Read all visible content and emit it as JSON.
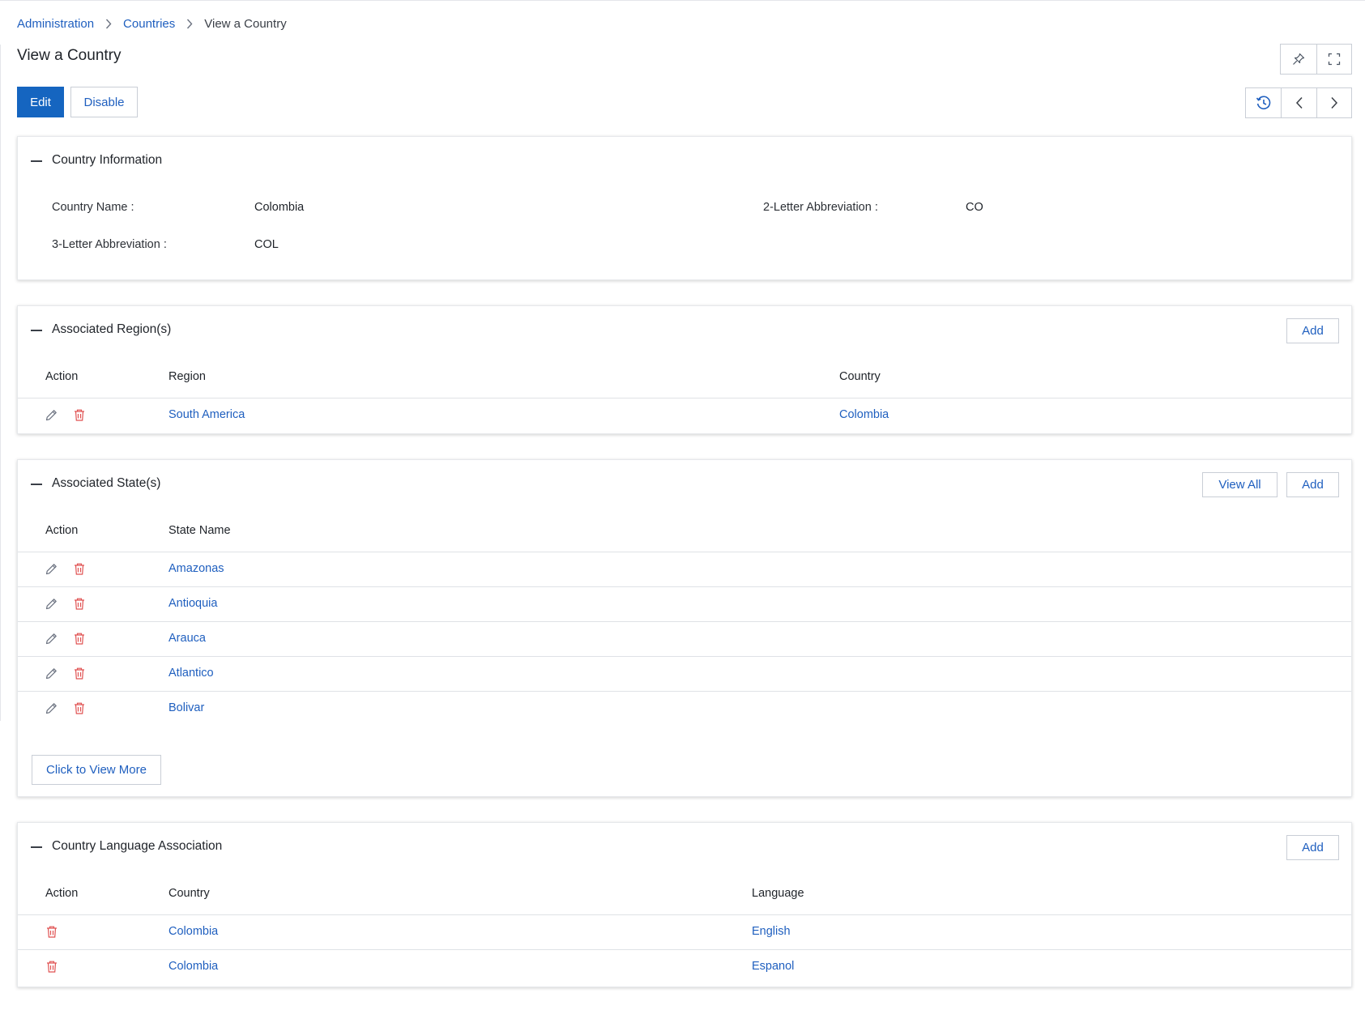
{
  "breadcrumb": {
    "items": [
      "Administration",
      "Countries"
    ],
    "current": "View a Country"
  },
  "page": {
    "title": "View a Country",
    "edit_label": "Edit",
    "disable_label": "Disable"
  },
  "country_info": {
    "title": "Country Information",
    "fields": {
      "country_name_label": "Country Name :",
      "country_name_value": "Colombia",
      "abbr2_label": "2-Letter Abbreviation :",
      "abbr2_value": "CO",
      "abbr3_label": "3-Letter Abbreviation :",
      "abbr3_value": "COL"
    }
  },
  "regions": {
    "title": "Associated Region(s)",
    "add_label": "Add",
    "columns": [
      "Action",
      "Region",
      "Country"
    ],
    "rows": [
      {
        "region": "South America",
        "country": "Colombia"
      }
    ]
  },
  "states": {
    "title": "Associated State(s)",
    "view_all_label": "View All",
    "add_label": "Add",
    "columns": [
      "Action",
      "State Name"
    ],
    "rows": [
      "Amazonas",
      "Antioquia",
      "Arauca",
      "Atlantico",
      "Bolivar"
    ],
    "more_label": "Click to View More"
  },
  "languages": {
    "title": "Country Language Association",
    "add_label": "Add",
    "columns": [
      "Action",
      "Country",
      "Language"
    ],
    "rows": [
      {
        "country": "Colombia",
        "language": "English"
      },
      {
        "country": "Colombia",
        "language": "Espanol"
      }
    ]
  },
  "icons": {
    "pin": "pin-icon",
    "expand": "expand-icon",
    "history": "history-icon",
    "prev": "chevron-left-icon",
    "next": "chevron-right-icon",
    "edit": "pencil-icon",
    "delete": "trash-icon",
    "collapse": "minus-icon"
  },
  "colors": {
    "primary": "#1565c0",
    "link": "#1f5fbf",
    "delete": "#e05252"
  }
}
